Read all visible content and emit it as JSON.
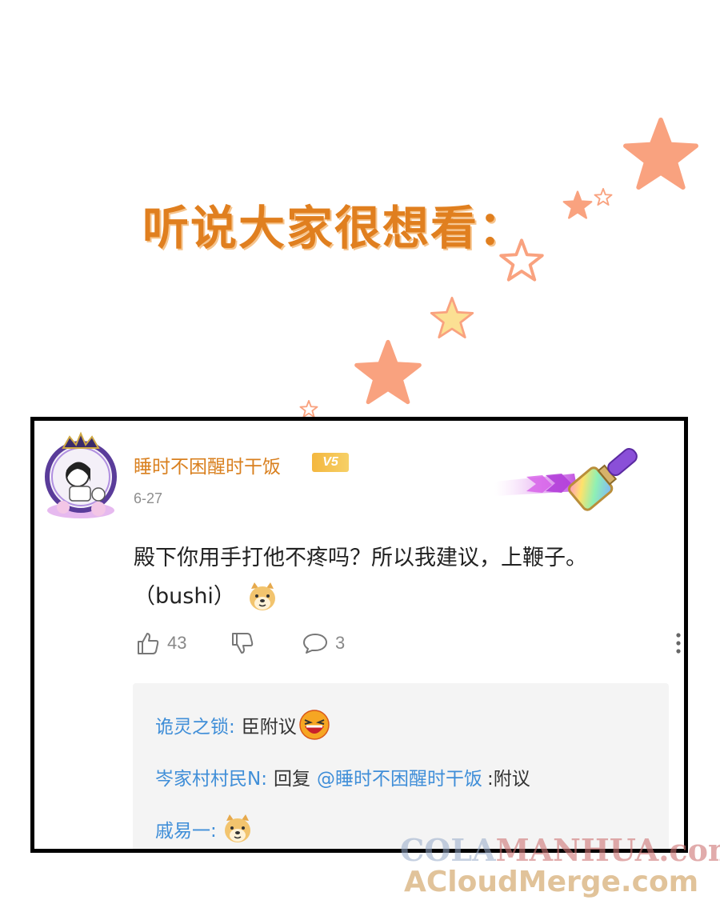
{
  "headline": "听说大家很想看：",
  "comment": {
    "username": "睡时不困醒时干饭",
    "vip_badge": "V5",
    "date": "6-27",
    "text_line1": "殿下你用手打他不疼吗？所以我建议，上鞭子。",
    "text_line2": "（bushi）",
    "likes": "43",
    "replies_count": "3",
    "icons": {
      "like": "thumbs-up-icon",
      "dislike": "thumbs-down-icon",
      "reply": "comment-bubble-icon",
      "more": "more-vertical-icon",
      "emoji_doge": "doge-emoji-icon",
      "emoji_laugh": "laughing-emoji-icon"
    }
  },
  "replies": [
    {
      "name": "诡灵之锁:",
      "text": "臣附议"
    },
    {
      "name": "岑家村村民N:",
      "text_prefix": "回复",
      "mention": "@睡时不困醒时干饭",
      "text": ":附议"
    },
    {
      "name": "戚易一:"
    }
  ],
  "watermark": {
    "line1_a": "COLA",
    "line1_b": "MANHUA",
    "line1_c": ".com",
    "line2": "ACloudMerge.com"
  },
  "colors": {
    "headline": "#e07f1f",
    "username": "#d9801f",
    "reply_name": "#3f8ed8",
    "star_salmon": "#f9a27f",
    "star_yellow": "#fbe093"
  }
}
